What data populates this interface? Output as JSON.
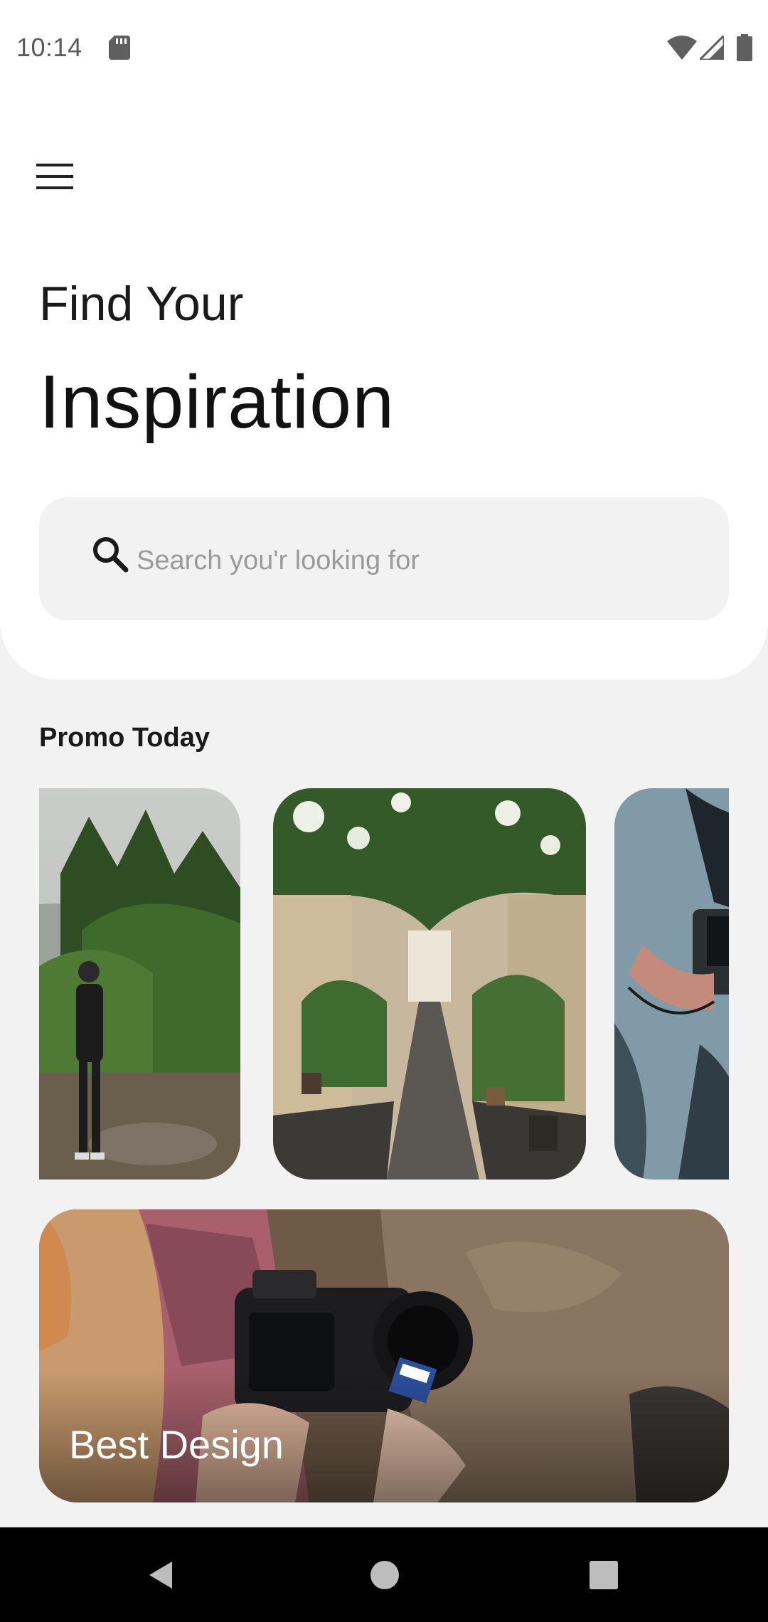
{
  "status_bar": {
    "time": "10:14",
    "icons": [
      "sd-card-icon",
      "wifi-icon",
      "signal-icon",
      "battery-icon"
    ]
  },
  "header": {
    "menu_icon": "hamburger-menu-icon",
    "title_line1": "Find Your",
    "title_line2": "Inspiration"
  },
  "search": {
    "icon": "search-icon",
    "placeholder": "Search you'r looking for",
    "value": ""
  },
  "promo": {
    "section_title": "Promo Today",
    "cards": [
      {
        "subject": "man-among-trees-photo"
      },
      {
        "subject": "flowered-alley-photo"
      },
      {
        "subject": "camera-hands-photo"
      }
    ]
  },
  "featured": {
    "label": "Best Design"
  },
  "nav_bar": {
    "buttons": [
      "back-icon",
      "home-icon",
      "recents-icon"
    ]
  },
  "colors": {
    "page_background": "#f2f2f2",
    "panel_background": "#ffffff",
    "search_background": "#f2f2f2",
    "placeholder_text": "#9a9a9a",
    "nav_bar_background": "#000000"
  }
}
